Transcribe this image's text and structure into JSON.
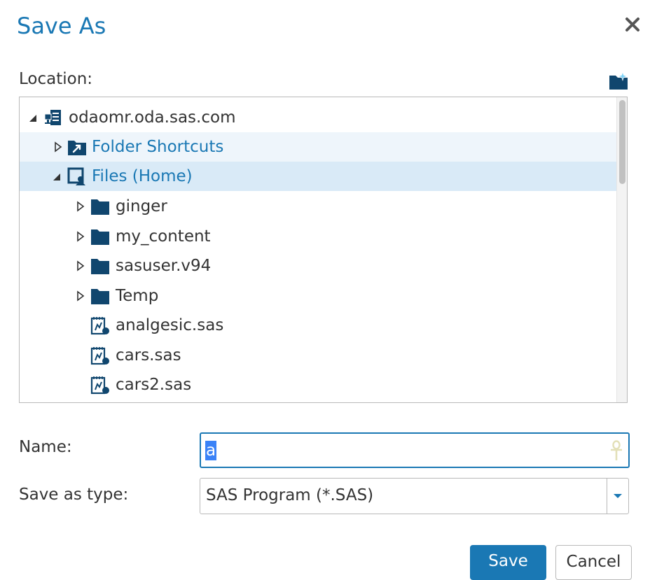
{
  "dialog": {
    "title": "Save As",
    "close_icon": "close-icon"
  },
  "location": {
    "label": "Location:",
    "new_folder_icon": "new-folder-icon"
  },
  "tree": {
    "server": {
      "label": "odaomr.oda.sas.com",
      "icon": "server-icon",
      "expanded": true
    },
    "shortcuts": {
      "label": "Folder Shortcuts",
      "icon": "folder-shortcut-icon",
      "expanded": false
    },
    "home": {
      "label": "Files (Home)",
      "icon": "home-folder-icon",
      "expanded": true,
      "selected": true
    },
    "folders": [
      {
        "label": "ginger",
        "icon": "folder-icon"
      },
      {
        "label": "my_content",
        "icon": "folder-icon"
      },
      {
        "label": "sasuser.v94",
        "icon": "folder-icon"
      },
      {
        "label": "Temp",
        "icon": "folder-icon"
      }
    ],
    "files": [
      {
        "label": "analgesic.sas",
        "icon": "sas-program-icon"
      },
      {
        "label": "cars.sas",
        "icon": "sas-program-icon"
      },
      {
        "label": "cars2.sas",
        "icon": "sas-program-icon"
      }
    ]
  },
  "name_field": {
    "label": "Name:",
    "value": "a"
  },
  "type_field": {
    "label": "Save as type:",
    "value": "SAS Program (*.SAS)"
  },
  "buttons": {
    "save": "Save",
    "cancel": "Cancel"
  },
  "colors": {
    "accent": "#1a78b4",
    "selected_row": "#d9eaf7",
    "hover_row": "#eef5fb",
    "icon_navy": "#10466e"
  }
}
